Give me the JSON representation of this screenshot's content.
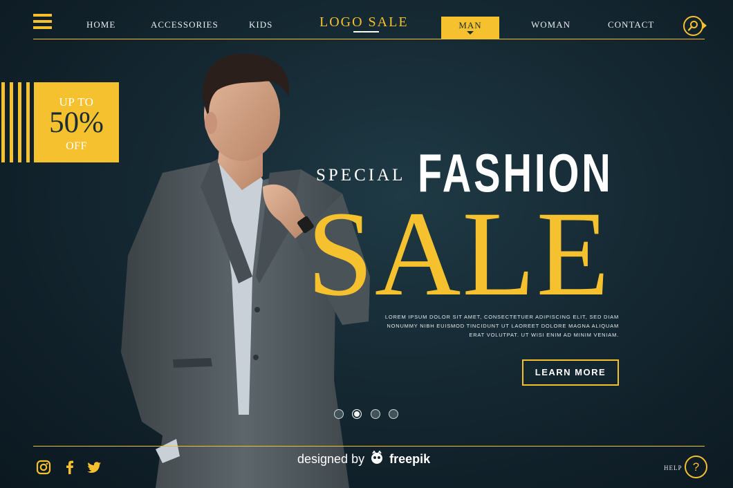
{
  "colors": {
    "accent": "#f6c12f",
    "background": "#132731",
    "text": "#ffffff"
  },
  "header": {
    "menu_icon": "hamburger-icon",
    "nav": {
      "home": "HOME",
      "accessories": "ACCESSORIES",
      "kids": "KIDS",
      "man": "MAN",
      "woman": "WOMAN",
      "contact": "CONTACT"
    },
    "logo": "LOGO SALE",
    "search_icon": "search-icon"
  },
  "promo": {
    "top": "UP TO",
    "percent": "50%",
    "bottom": "OFF"
  },
  "hero": {
    "special": "SPECIAL",
    "fashion": "FASHION",
    "sale": "SALE",
    "description": "LOREM IPSUM DOLOR SIT AMET, CONSECTETUER ADIPISCING ELIT, SED DIAM NONUMMY NIBH EUISMOD TINCIDUNT UT LAOREET DOLORE MAGNA ALIQUAM ERAT VOLUTPAT. UT WISI ENIM AD MINIM VENIAM.",
    "cta": "LEARN MORE"
  },
  "slider": {
    "count": 4,
    "active_index": 1
  },
  "footer": {
    "social_icons": [
      "instagram-icon",
      "facebook-icon",
      "twitter-icon"
    ],
    "credit_prefix": "designed by",
    "credit_brand": "freepik",
    "help_label": "HELP",
    "help_icon": "?"
  }
}
